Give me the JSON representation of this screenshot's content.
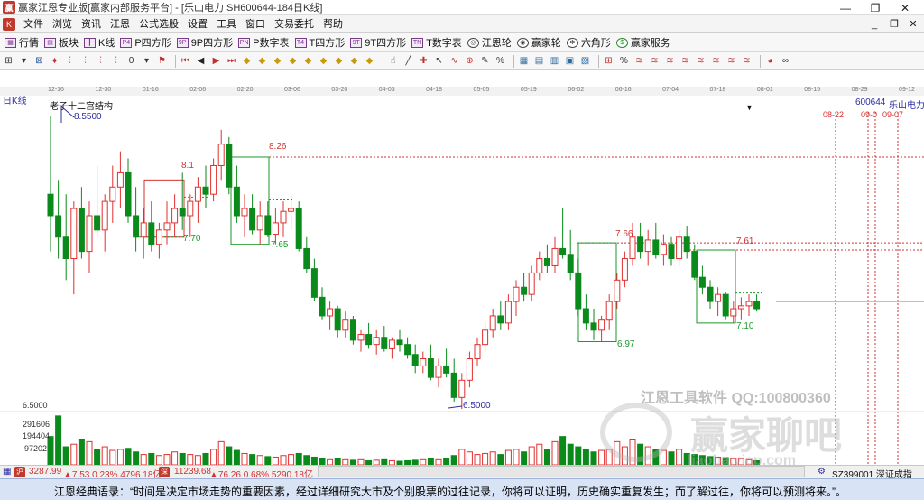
{
  "window": {
    "title": "赢家江恩专业版[赢家内部服务平台] - [乐山电力  SH600644-184日K线]",
    "minimize": "—",
    "restore": "❐",
    "close": "✕"
  },
  "menu": {
    "items": [
      "文件",
      "浏览",
      "资讯",
      "江恩",
      "公式选股",
      "设置",
      "工具",
      "窗口",
      "交易委托",
      "帮助"
    ],
    "mdi_buttons": [
      "_",
      "❐",
      "✕"
    ]
  },
  "toolbar": {
    "buttons": [
      {
        "label": "行情",
        "icon": "grid-icon"
      },
      {
        "label": "板块",
        "icon": "blocks-icon"
      },
      {
        "label": "K线",
        "icon": "kline-icon"
      },
      {
        "label": "P四方形",
        "icon": "p4-icon",
        "tag": "P4"
      },
      {
        "label": "9P四方形",
        "icon": "9p4-icon",
        "tag": "9P"
      },
      {
        "label": "P数字表",
        "icon": "pnum-icon",
        "tag": "PN"
      },
      {
        "label": "T四方形",
        "icon": "t4-icon",
        "tag": "T4"
      },
      {
        "label": "9T四方形",
        "icon": "9t4-icon",
        "tag": "9T"
      },
      {
        "label": "T数字表",
        "icon": "tnum-icon",
        "tag": "TN"
      },
      {
        "label": "江恩轮",
        "icon": "gann-wheel-icon"
      },
      {
        "label": "赢家轮",
        "icon": "winner-wheel-icon"
      },
      {
        "label": "六角形",
        "icon": "hexagon-icon"
      },
      {
        "label": "赢家服务",
        "icon": "dollar-icon"
      }
    ]
  },
  "dates": [
    "12-16",
    "12-30",
    "01-16",
    "02-06",
    "02-20",
    "03-06",
    "03-20",
    "04-03",
    "04-18",
    "05-05",
    "05-19",
    "06-02",
    "06-16",
    "07-04",
    "07-18",
    "08-01",
    "08-15",
    "08-29",
    "09-12"
  ],
  "chart": {
    "period_label": "日K线",
    "indicator_label": "老子十二宫结构",
    "stock_code": "600644",
    "stock_name": "乐山电力",
    "high_label": "8.5500",
    "low_label": "6.5000",
    "axis_price": "6.5000",
    "vol_ticks": [
      "291606",
      "194404",
      "97202"
    ],
    "future_dates": [
      "08-22",
      "09-0",
      "09-07"
    ],
    "box_labels": [
      "8.1",
      "7.70",
      "8.26",
      "7.65",
      "7.66",
      "6.97",
      "7.61",
      "7.10"
    ]
  },
  "chart_data": {
    "type": "candlestick",
    "title": "老子十二宫结构",
    "x_tick_labels": [
      "12-16",
      "12-30",
      "01-16",
      "02-06",
      "02-20",
      "03-06",
      "03-20",
      "04-03",
      "04-18",
      "05-05",
      "05-19",
      "06-02",
      "06-16",
      "07-04",
      "07-18",
      "08-01",
      "08-15",
      "08-29",
      "09-12"
    ],
    "price_marks": {
      "high": 8.55,
      "low": 6.5
    },
    "levels": [
      8.26,
      8.1,
      7.7,
      7.66,
      7.65,
      7.61,
      7.1,
      6.97
    ],
    "volume_ticks": [
      291606,
      194404,
      97202
    ],
    "ohlc": [
      [
        8.0,
        8.55,
        7.6,
        7.85
      ],
      [
        7.85,
        8.1,
        7.55,
        7.7
      ],
      [
        7.7,
        8.0,
        7.4,
        7.55
      ],
      [
        7.55,
        7.95,
        7.3,
        7.9
      ],
      [
        7.9,
        8.05,
        7.55,
        7.6
      ],
      [
        7.6,
        7.95,
        7.45,
        7.85
      ],
      [
        7.85,
        8.2,
        7.7,
        7.75
      ],
      [
        7.75,
        8.0,
        7.6,
        7.95
      ],
      [
        7.95,
        8.2,
        7.8,
        8.05
      ],
      [
        8.05,
        8.3,
        7.9,
        8.15
      ],
      [
        8.15,
        8.25,
        7.8,
        7.85
      ],
      [
        7.85,
        8.05,
        7.6,
        7.7
      ],
      [
        7.7,
        7.9,
        7.55,
        7.8
      ],
      [
        7.8,
        7.95,
        7.6,
        7.65
      ],
      [
        7.65,
        7.8,
        7.55,
        7.75
      ],
      [
        7.75,
        7.95,
        7.65,
        7.8
      ],
      [
        7.8,
        8.0,
        7.7,
        7.9
      ],
      [
        7.9,
        8.15,
        7.75,
        7.85
      ],
      [
        7.85,
        8.0,
        7.7,
        7.95
      ],
      [
        7.95,
        8.12,
        7.8,
        8.05
      ],
      [
        8.05,
        8.2,
        7.9,
        8.0
      ],
      [
        8.0,
        8.25,
        7.95,
        8.2
      ],
      [
        8.2,
        8.45,
        8.1,
        8.35
      ],
      [
        8.35,
        8.4,
        8.0,
        8.05
      ],
      [
        8.05,
        8.2,
        7.8,
        7.85
      ],
      [
        7.85,
        8.0,
        7.7,
        7.9
      ],
      [
        7.9,
        8.0,
        7.72,
        7.75
      ],
      [
        7.75,
        7.95,
        7.65,
        7.85
      ],
      [
        7.85,
        7.95,
        7.7,
        7.72
      ],
      [
        7.72,
        7.9,
        7.65,
        7.8
      ],
      [
        7.8,
        7.95,
        7.7,
        7.88
      ],
      [
        7.88,
        8.0,
        7.75,
        7.9
      ],
      [
        7.9,
        7.95,
        7.6,
        7.62
      ],
      [
        7.62,
        7.7,
        7.45,
        7.48
      ],
      [
        7.48,
        7.55,
        7.25,
        7.28
      ],
      [
        7.28,
        7.35,
        7.12,
        7.15
      ],
      [
        7.15,
        7.25,
        7.05,
        7.2
      ],
      [
        7.2,
        7.22,
        7.0,
        7.05
      ],
      [
        7.05,
        7.18,
        7.0,
        7.12
      ],
      [
        7.12,
        7.15,
        6.95,
        6.98
      ],
      [
        6.98,
        7.05,
        6.9,
        7.02
      ],
      [
        7.02,
        7.1,
        6.92,
        6.95
      ],
      [
        6.95,
        7.05,
        6.88,
        7.0
      ],
      [
        7.0,
        7.08,
        6.9,
        6.92
      ],
      [
        6.92,
        7.0,
        6.85,
        6.98
      ],
      [
        6.98,
        7.05,
        6.9,
        6.95
      ],
      [
        6.95,
        7.0,
        6.85,
        6.88
      ],
      [
        6.88,
        6.95,
        6.75,
        6.8
      ],
      [
        6.8,
        6.9,
        6.75,
        6.85
      ],
      [
        6.85,
        6.95,
        6.7,
        6.72
      ],
      [
        6.72,
        6.85,
        6.65,
        6.8
      ],
      [
        6.8,
        6.92,
        6.72,
        6.75
      ],
      [
        6.75,
        6.85,
        6.55,
        6.58
      ],
      [
        6.58,
        6.75,
        6.5,
        6.7
      ],
      [
        6.7,
        6.9,
        6.65,
        6.85
      ],
      [
        6.85,
        7.0,
        6.8,
        6.95
      ],
      [
        6.95,
        7.1,
        6.9,
        7.05
      ],
      [
        7.05,
        7.2,
        7.0,
        7.15
      ],
      [
        7.15,
        7.25,
        7.05,
        7.1
      ],
      [
        7.1,
        7.3,
        7.05,
        7.25
      ],
      [
        7.25,
        7.4,
        7.15,
        7.35
      ],
      [
        7.35,
        7.45,
        7.25,
        7.3
      ],
      [
        7.3,
        7.5,
        7.25,
        7.45
      ],
      [
        7.45,
        7.6,
        7.4,
        7.55
      ],
      [
        7.55,
        7.65,
        7.45,
        7.5
      ],
      [
        7.5,
        7.7,
        7.45,
        7.62
      ],
      [
        7.62,
        7.9,
        7.55,
        7.58
      ],
      [
        7.58,
        7.75,
        7.4,
        7.45
      ],
      [
        7.45,
        7.55,
        7.15,
        7.2
      ],
      [
        7.2,
        7.3,
        7.05,
        7.1
      ],
      [
        7.1,
        7.2,
        6.98,
        7.05
      ],
      [
        7.05,
        7.15,
        6.97,
        7.12
      ],
      [
        7.12,
        7.3,
        7.05,
        7.25
      ],
      [
        7.25,
        7.45,
        7.2,
        7.4
      ],
      [
        7.4,
        7.6,
        7.35,
        7.55
      ],
      [
        7.55,
        7.8,
        7.5,
        7.7
      ],
      [
        7.7,
        7.8,
        7.55,
        7.6
      ],
      [
        7.6,
        7.75,
        7.5,
        7.68
      ],
      [
        7.68,
        7.8,
        7.55,
        7.58
      ],
      [
        7.58,
        7.72,
        7.5,
        7.65
      ],
      [
        7.65,
        7.7,
        7.5,
        7.55
      ],
      [
        7.55,
        7.75,
        7.5,
        7.7
      ],
      [
        7.7,
        7.78,
        7.55,
        7.6
      ],
      [
        7.6,
        7.65,
        7.4,
        7.42
      ],
      [
        7.42,
        7.5,
        7.3,
        7.35
      ],
      [
        7.35,
        7.4,
        7.2,
        7.25
      ],
      [
        7.25,
        7.35,
        7.15,
        7.3
      ],
      [
        7.3,
        7.32,
        7.12,
        7.15
      ],
      [
        7.15,
        7.25,
        7.1,
        7.2
      ],
      [
        7.2,
        7.28,
        7.12,
        7.22
      ],
      [
        7.22,
        7.3,
        7.15,
        7.25
      ],
      [
        7.25,
        7.3,
        7.18,
        7.2
      ]
    ],
    "volume": [
      0.55,
      0.95,
      0.35,
      0.4,
      0.5,
      0.45,
      0.3,
      0.35,
      0.28,
      0.3,
      0.32,
      0.25,
      0.2,
      0.22,
      0.18,
      0.2,
      0.25,
      0.22,
      0.2,
      0.18,
      0.22,
      0.3,
      0.45,
      0.35,
      0.28,
      0.22,
      0.2,
      0.18,
      0.16,
      0.15,
      0.18,
      0.2,
      0.22,
      0.18,
      0.15,
      0.12,
      0.1,
      0.12,
      0.1,
      0.09,
      0.1,
      0.08,
      0.09,
      0.1,
      0.08,
      0.07,
      0.08,
      0.09,
      0.1,
      0.12,
      0.1,
      0.12,
      0.18,
      0.3,
      0.25,
      0.2,
      0.22,
      0.25,
      0.2,
      0.28,
      0.3,
      0.25,
      0.35,
      0.4,
      0.3,
      0.45,
      0.55,
      0.4,
      0.35,
      0.3,
      0.25,
      0.28,
      0.3,
      0.45,
      0.35,
      0.5,
      0.4,
      0.35,
      0.3,
      0.28,
      0.25,
      0.3,
      0.22,
      0.2,
      0.18,
      0.16,
      0.15,
      0.14,
      0.12,
      0.12,
      0.1,
      0.08
    ]
  },
  "status": {
    "sh_index": "3287.99",
    "sh_change": "▲7.53 0.23% 4796.18亿",
    "sz_index": "11239.68",
    "sz_change": "▲76.26 0.68% 5290.18亿",
    "right_text": "SZ399001 深证成指"
  },
  "quote": "江恩经典语录：“时间是决定市场走势的重要因素，经过详细研究大市及个别股票的过往记录，你将可以证明，历史确实重复发生；而了解过往，你将可以预测将来。”。",
  "watermark": {
    "software": "江恩工具软件  QQ:100800360",
    "forum": "赢家聊吧",
    "site": "liaoba.yjcp.com"
  },
  "colors": {
    "up": "#e03030",
    "down": "#0a8a1a",
    "level_red": "#d23232",
    "box_green": "#1a9a2a",
    "accent_blue": "#2c2ca0"
  }
}
